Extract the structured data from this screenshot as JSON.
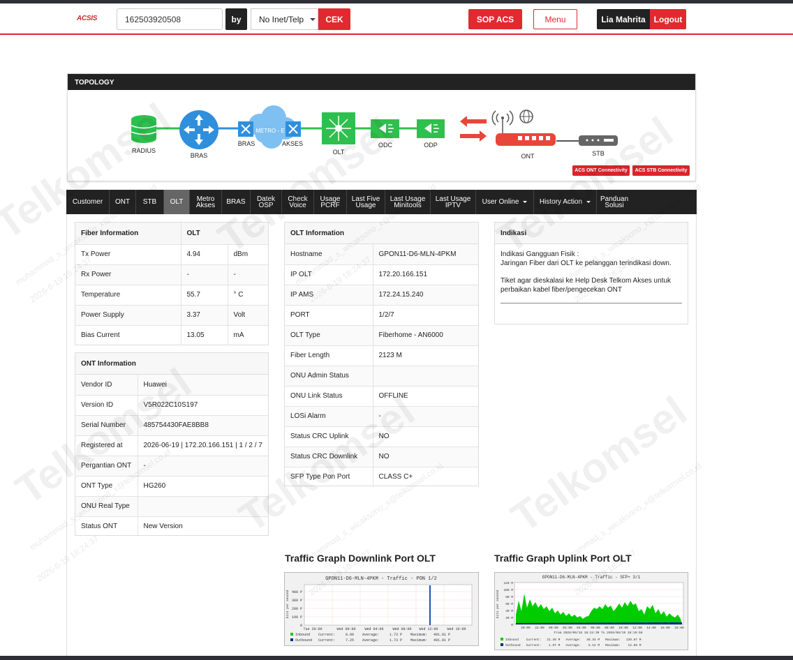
{
  "header": {
    "logo": "ACSIS",
    "search_value": "162503920508",
    "by_label": "by",
    "search_type": "No Inet/Telp",
    "cek_label": "CEK",
    "sop_label": "SOP ACS",
    "menu_label": "Menu",
    "user_name": "Lia Mahrita",
    "logout_label": "Logout"
  },
  "topology": {
    "title": "TOPOLOGY",
    "nodes": {
      "radius": "RADIUS",
      "bras": "BRAS",
      "metro": "METRO - E",
      "bras2": "BRAS",
      "akses": "AKSES",
      "olt": "OLT",
      "odc": "ODC",
      "odp": "ODP",
      "ont": "ONT",
      "stb": "STB"
    },
    "acs_ont": "ACS ONT Connectivity",
    "acs_stb": "ACS STB Connectivity",
    "colors": {
      "green": "#2fbf4f",
      "blue": "#2f8fdc",
      "red": "#e8463a"
    }
  },
  "tabs": [
    "Customer",
    "ONT",
    "STB",
    "OLT",
    "Metro\nAkses",
    "BRAS",
    "Datek\nOSP",
    "Check\nVoice",
    "Usage\nPCRF",
    "Last Five\nUsage",
    "Last Usage\nMinitools",
    "Last Usage\nIPTV",
    "User Online",
    "History Action",
    "Panduan\nSolusi"
  ],
  "fiber": {
    "title": "Fiber Information",
    "col2": "OLT",
    "rows": [
      [
        "Tx Power",
        "4.94",
        "dBm"
      ],
      [
        "Rx Power",
        "-",
        "-"
      ],
      [
        "Temperature",
        "55.7",
        "° C"
      ],
      [
        "Power Supply",
        "3.37",
        "Volt"
      ],
      [
        "Bias Current",
        "13.05",
        "mA"
      ]
    ]
  },
  "ont": {
    "title": "ONT Information",
    "rows": [
      [
        "Vendor ID",
        "Huawei"
      ],
      [
        "Version ID",
        "V5R022C10S197"
      ],
      [
        "Serial Number",
        "485754430FAE8BB8"
      ],
      [
        "Registered at",
        "2026-06-19 | 172.20.166.151 | 1 / 2 / 7"
      ],
      [
        "Pergantian ONT",
        "-"
      ],
      [
        "ONT Type",
        "HG260"
      ],
      [
        "ONU Real Type",
        ""
      ],
      [
        "Status ONT",
        "New Version"
      ]
    ]
  },
  "olt": {
    "title": "OLT Information",
    "rows": [
      [
        "Hostname",
        "GPON11-D6-MLN-4PKM"
      ],
      [
        "IP OLT",
        "172.20.166.151"
      ],
      [
        "IP AMS",
        "172.24.15.240"
      ],
      [
        "PORT",
        "1/2/7"
      ],
      [
        "OLT Type",
        "Fiberhome - AN6000"
      ],
      [
        "Fiber Length",
        "2123 M"
      ],
      [
        "ONU Admin Status",
        ""
      ],
      [
        "ONU Link Status",
        "OFFLINE"
      ],
      [
        "LOSi Alarm",
        "-"
      ],
      [
        "Status CRC Uplink",
        "NO"
      ],
      [
        "Status CRC Downlink",
        "NO"
      ],
      [
        "SFP Type Pon Port",
        "CLASS C+"
      ]
    ]
  },
  "indikasi": {
    "title": "Indikasi",
    "line1": "Indikasi Gangguan Fisik :",
    "line2": "Jaringan Fiber dari OLT ke pelanggan terindikasi down.",
    "line3": "Tiket agar dieskalasi ke Help Desk Telkom Akses untuk perbaikan kabel fiber/pengecekan ONT"
  },
  "graphs": {
    "down_title": "Traffic Graph Downlink Port OLT",
    "up_title": "Traffic Graph Uplink Port OLT",
    "down_caption": "GPON11-D6-MLN-4PKM - Traffic - PON 1/2",
    "up_caption": "GPON11-D6-MLN-4PKM - Traffic - SFP+ 3/1",
    "down_y_ticks": [
      "400 P",
      "300 P",
      "200 P",
      "100 P",
      "0"
    ],
    "down_x_ticks": [
      "Tue 20:00",
      "Wed 00:00",
      "Wed 04:00",
      "Wed 08:00",
      "Wed 12:00",
      "Wed 16:00"
    ],
    "up_y_ticks": [
      "120 M",
      "100 M",
      "80 M",
      "60 M",
      "40 M",
      "20 M",
      "0"
    ],
    "up_x_ticks": [
      "20:00",
      "22:00",
      "00:00",
      "02:00",
      "04:00",
      "06:00",
      "08:00",
      "10:00",
      "12:00",
      "14:00",
      "16:00",
      "18:00"
    ],
    "y_unit": "bits per second",
    "up_from": "From 2026/06/18 18:24:39 To 2026/06/19 18:19:58",
    "down_legend": [
      "Inbound    Current:     0.00    Average:     1.73 P    Maximum:   491.91 P",
      "Outbound   Current:     7.25    Average:     1.73 P    Maximum:   491.91 P"
    ],
    "up_legend": [
      "Inbound    Current:   21.46 M   Average:   38.34 M   Maximum:   139.87 M",
      "Outbound   Current:    1.97 M   Average:    5.12 M   Maximum:    12.85 M"
    ],
    "colors": {
      "inbound": "#00cc00",
      "outbound": "#002a97",
      "spike": "#1d50b4"
    }
  },
  "watermark": {
    "brand": "Telkomsel",
    "user": "muhammad_s_wicaksono_x@telkomsel.co.id",
    "stamp": "2026-6-19 18:24:37"
  }
}
